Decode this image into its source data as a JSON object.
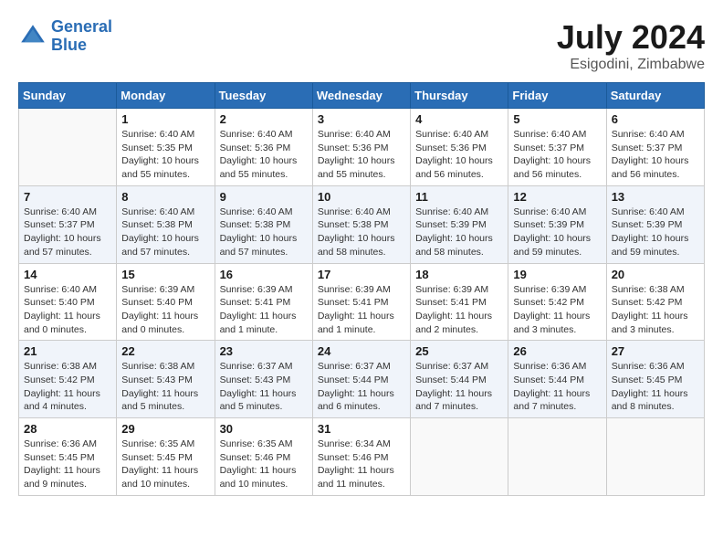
{
  "header": {
    "logo_line1": "General",
    "logo_line2": "Blue",
    "month_title": "July 2024",
    "location": "Esigodini, Zimbabwe"
  },
  "days_of_week": [
    "Sunday",
    "Monday",
    "Tuesday",
    "Wednesday",
    "Thursday",
    "Friday",
    "Saturday"
  ],
  "weeks": [
    [
      {
        "day": "",
        "info": ""
      },
      {
        "day": "1",
        "info": "Sunrise: 6:40 AM\nSunset: 5:35 PM\nDaylight: 10 hours\nand 55 minutes."
      },
      {
        "day": "2",
        "info": "Sunrise: 6:40 AM\nSunset: 5:36 PM\nDaylight: 10 hours\nand 55 minutes."
      },
      {
        "day": "3",
        "info": "Sunrise: 6:40 AM\nSunset: 5:36 PM\nDaylight: 10 hours\nand 55 minutes."
      },
      {
        "day": "4",
        "info": "Sunrise: 6:40 AM\nSunset: 5:36 PM\nDaylight: 10 hours\nand 56 minutes."
      },
      {
        "day": "5",
        "info": "Sunrise: 6:40 AM\nSunset: 5:37 PM\nDaylight: 10 hours\nand 56 minutes."
      },
      {
        "day": "6",
        "info": "Sunrise: 6:40 AM\nSunset: 5:37 PM\nDaylight: 10 hours\nand 56 minutes."
      }
    ],
    [
      {
        "day": "7",
        "info": "Sunrise: 6:40 AM\nSunset: 5:37 PM\nDaylight: 10 hours\nand 57 minutes."
      },
      {
        "day": "8",
        "info": "Sunrise: 6:40 AM\nSunset: 5:38 PM\nDaylight: 10 hours\nand 57 minutes."
      },
      {
        "day": "9",
        "info": "Sunrise: 6:40 AM\nSunset: 5:38 PM\nDaylight: 10 hours\nand 57 minutes."
      },
      {
        "day": "10",
        "info": "Sunrise: 6:40 AM\nSunset: 5:38 PM\nDaylight: 10 hours\nand 58 minutes."
      },
      {
        "day": "11",
        "info": "Sunrise: 6:40 AM\nSunset: 5:39 PM\nDaylight: 10 hours\nand 58 minutes."
      },
      {
        "day": "12",
        "info": "Sunrise: 6:40 AM\nSunset: 5:39 PM\nDaylight: 10 hours\nand 59 minutes."
      },
      {
        "day": "13",
        "info": "Sunrise: 6:40 AM\nSunset: 5:39 PM\nDaylight: 10 hours\nand 59 minutes."
      }
    ],
    [
      {
        "day": "14",
        "info": "Sunrise: 6:40 AM\nSunset: 5:40 PM\nDaylight: 11 hours\nand 0 minutes."
      },
      {
        "day": "15",
        "info": "Sunrise: 6:39 AM\nSunset: 5:40 PM\nDaylight: 11 hours\nand 0 minutes."
      },
      {
        "day": "16",
        "info": "Sunrise: 6:39 AM\nSunset: 5:41 PM\nDaylight: 11 hours\nand 1 minute."
      },
      {
        "day": "17",
        "info": "Sunrise: 6:39 AM\nSunset: 5:41 PM\nDaylight: 11 hours\nand 1 minute."
      },
      {
        "day": "18",
        "info": "Sunrise: 6:39 AM\nSunset: 5:41 PM\nDaylight: 11 hours\nand 2 minutes."
      },
      {
        "day": "19",
        "info": "Sunrise: 6:39 AM\nSunset: 5:42 PM\nDaylight: 11 hours\nand 3 minutes."
      },
      {
        "day": "20",
        "info": "Sunrise: 6:38 AM\nSunset: 5:42 PM\nDaylight: 11 hours\nand 3 minutes."
      }
    ],
    [
      {
        "day": "21",
        "info": "Sunrise: 6:38 AM\nSunset: 5:42 PM\nDaylight: 11 hours\nand 4 minutes."
      },
      {
        "day": "22",
        "info": "Sunrise: 6:38 AM\nSunset: 5:43 PM\nDaylight: 11 hours\nand 5 minutes."
      },
      {
        "day": "23",
        "info": "Sunrise: 6:37 AM\nSunset: 5:43 PM\nDaylight: 11 hours\nand 5 minutes."
      },
      {
        "day": "24",
        "info": "Sunrise: 6:37 AM\nSunset: 5:44 PM\nDaylight: 11 hours\nand 6 minutes."
      },
      {
        "day": "25",
        "info": "Sunrise: 6:37 AM\nSunset: 5:44 PM\nDaylight: 11 hours\nand 7 minutes."
      },
      {
        "day": "26",
        "info": "Sunrise: 6:36 AM\nSunset: 5:44 PM\nDaylight: 11 hours\nand 7 minutes."
      },
      {
        "day": "27",
        "info": "Sunrise: 6:36 AM\nSunset: 5:45 PM\nDaylight: 11 hours\nand 8 minutes."
      }
    ],
    [
      {
        "day": "28",
        "info": "Sunrise: 6:36 AM\nSunset: 5:45 PM\nDaylight: 11 hours\nand 9 minutes."
      },
      {
        "day": "29",
        "info": "Sunrise: 6:35 AM\nSunset: 5:45 PM\nDaylight: 11 hours\nand 10 minutes."
      },
      {
        "day": "30",
        "info": "Sunrise: 6:35 AM\nSunset: 5:46 PM\nDaylight: 11 hours\nand 10 minutes."
      },
      {
        "day": "31",
        "info": "Sunrise: 6:34 AM\nSunset: 5:46 PM\nDaylight: 11 hours\nand 11 minutes."
      },
      {
        "day": "",
        "info": ""
      },
      {
        "day": "",
        "info": ""
      },
      {
        "day": "",
        "info": ""
      }
    ]
  ]
}
